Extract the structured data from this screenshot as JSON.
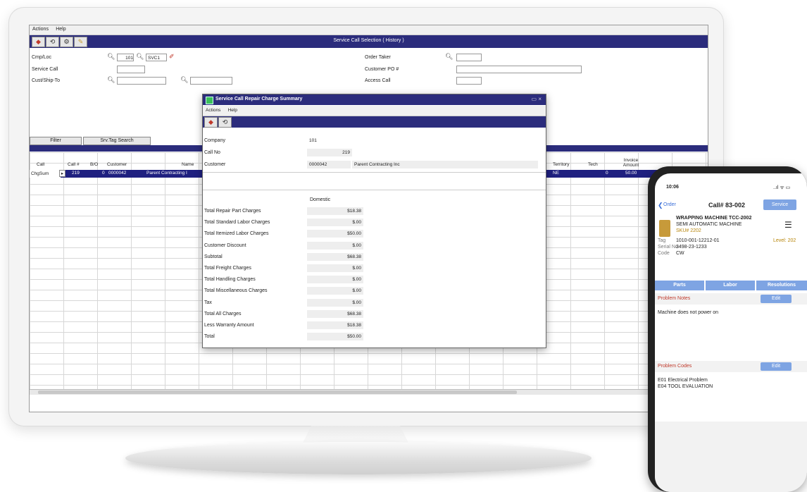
{
  "desktop": {
    "menu": [
      "Actions",
      "Help"
    ],
    "window_title": "Service Call Selection ( History )",
    "form": {
      "cmp_loc_label": "Cmp/Loc",
      "cmp_value": "101",
      "loc_value": "SVC1",
      "service_call_label": "Service Call",
      "cust_ship_label": "Cust/Ship-To",
      "order_taker_label": "Order Taker",
      "customer_po_label": "Customer PO #",
      "access_call_label": "Access Call"
    },
    "filter_button": "Filter",
    "tag_search_button": "Srv.Tag Search",
    "grid": {
      "headers": [
        "Call",
        "Call #",
        "B/O",
        "Customer",
        "Name",
        "Territory",
        "Tech",
        "Invoice Amount"
      ],
      "row": {
        "type": "ChgSum",
        "call": "219",
        "bo": "0",
        "customer": "0000042",
        "name": "Parent Contracting I",
        "territory": "NE",
        "tech": "0",
        "amount": "50.00"
      }
    }
  },
  "dialog": {
    "title": "Service Call Repair Charge Summary",
    "menu": [
      "Actions",
      "Help"
    ],
    "company_label": "Company",
    "company_value": "101",
    "call_no_label": "Call No",
    "call_no_value": "219",
    "customer_label": "Customer",
    "customer_number": "0000042",
    "customer_name": "Parent Contracting Inc",
    "column_header": "Domestic",
    "charges": [
      {
        "label": "Total Repair Part Charges",
        "value": "$18.38"
      },
      {
        "label": "Total Standard Labor Charges",
        "value": "$.00"
      },
      {
        "label": "Total Itemized Labor Charges",
        "value": "$50.00"
      },
      {
        "label": "Customer Discount",
        "value": "$.00"
      },
      {
        "label": "Subtotal",
        "value": "$68.38"
      },
      {
        "label": "Total Freight Charges",
        "value": "$.00"
      },
      {
        "label": "Total Handling Charges",
        "value": "$.00"
      },
      {
        "label": "Total Miscellaneous Charges",
        "value": "$.00"
      },
      {
        "label": "Tax",
        "value": "$.00"
      },
      {
        "label": "Total All Charges",
        "value": "$68.38"
      },
      {
        "label": "Less Warranty Amount",
        "value": "$18.38"
      },
      {
        "label": "Total",
        "value": "$50.00"
      }
    ]
  },
  "phone": {
    "time": "10:06",
    "status_icons": "..ıl ᯤ ▭",
    "back_label": "Order",
    "call_title": "Call# 83-002",
    "action_button": "Service",
    "machine_name": "WRAPPING MACHINE TCC-2002",
    "machine_type": "SEMI AUTOMATIC MACHINE",
    "machine_sku": "SKU# 2202",
    "tag_label": "Tag",
    "tag_value": "1010-001-12212-01",
    "level_label": "Level: 202",
    "serial_label": "Serial No",
    "serial_value": "3498-23-1233",
    "code_label": "Code",
    "code_value": "CW",
    "tabs": [
      "Parts",
      "Labor",
      "Resolutions"
    ],
    "notes_title": "Problem Notes",
    "notes_text": "Machine does not power on",
    "edit_label": "Edit",
    "codes_title": "Problem Codes",
    "codes": [
      "E01 Electrical Problem",
      "E04 TOOL EVALUATION"
    ]
  },
  "colors": {
    "navy": "#2b2c7c",
    "phone_accent": "#7ea4e3",
    "problem_title": "#c0392b",
    "machine_sku": "#b8860b"
  }
}
